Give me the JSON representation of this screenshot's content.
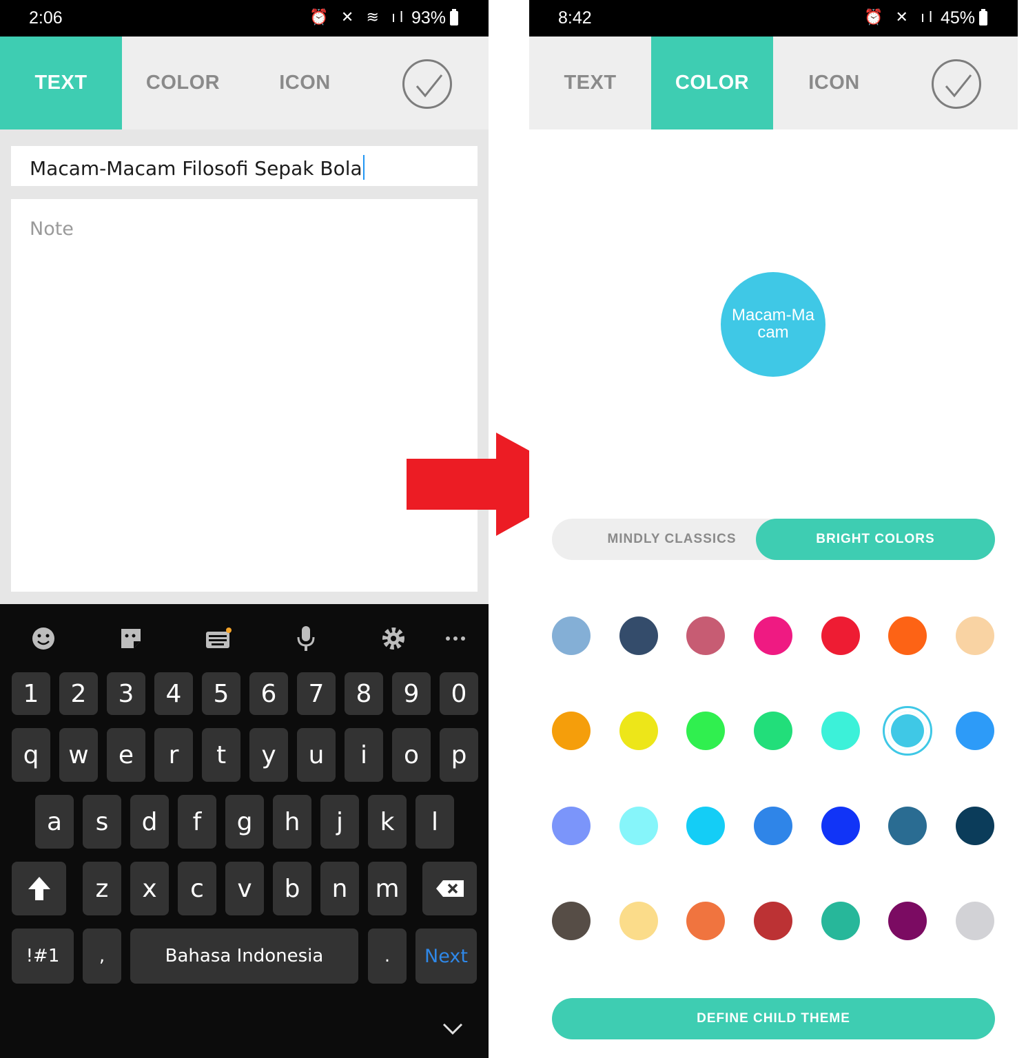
{
  "left": {
    "status": {
      "time": "2:06",
      "battery": "93%",
      "icons": "⏰🔇"
    },
    "tabs": [
      {
        "label": "TEXT",
        "active": true
      },
      {
        "label": "COLOR",
        "active": false
      },
      {
        "label": "ICON",
        "active": false
      }
    ],
    "title_value": "Macam-Macam Filosofi Sepak Bola",
    "note_placeholder": "Note",
    "keyboard": {
      "number_row": [
        "1",
        "2",
        "3",
        "4",
        "5",
        "6",
        "7",
        "8",
        "9",
        "0"
      ],
      "row1": [
        "q",
        "w",
        "e",
        "r",
        "t",
        "y",
        "u",
        "i",
        "o",
        "p"
      ],
      "row2": [
        "a",
        "s",
        "d",
        "f",
        "g",
        "h",
        "j",
        "k",
        "l"
      ],
      "row3": [
        "z",
        "x",
        "c",
        "v",
        "b",
        "n",
        "m"
      ],
      "symbols_key": "!#1",
      "comma_key": ",",
      "space_label": "Bahasa Indonesia",
      "period_key": ".",
      "next_key": "Next"
    }
  },
  "right": {
    "status": {
      "time": "8:42",
      "battery": "45%",
      "icons": "⏰🔇"
    },
    "tabs": [
      {
        "label": "TEXT",
        "active": false
      },
      {
        "label": "COLOR",
        "active": true
      },
      {
        "label": "ICON",
        "active": false
      }
    ],
    "bubble_line1": "Macam-Ma",
    "bubble_line2": "cam",
    "segments": {
      "classics": "MINDLY CLASSICS",
      "bright": "BRIGHT COLORS"
    },
    "swatches": [
      [
        "#84afd6",
        "#344c6b",
        "#c75c73",
        "#ef1a82",
        "#ee1c33",
        "#fd6315",
        "#f9d3a3"
      ],
      [
        "#f59e0b",
        "#ede619",
        "#30ef4f",
        "#22de7a",
        "#3cf1d9",
        "#3fc8e6",
        "#2d9bf8"
      ],
      [
        "#7b95fa",
        "#86f5fa",
        "#14cdf6",
        "#2f85e8",
        "#1134f7",
        "#2a6c92",
        "#0b3c5a"
      ],
      [
        "#564d46",
        "#fbdc8a",
        "#f0743f",
        "#bc3234",
        "#27b79a",
        "#7b0b62",
        "#d2d2d6"
      ]
    ],
    "selected_swatch": "#3fc8e6",
    "define_child_theme": "DEFINE CHILD THEME"
  },
  "arrow_color": "#ec1c24"
}
